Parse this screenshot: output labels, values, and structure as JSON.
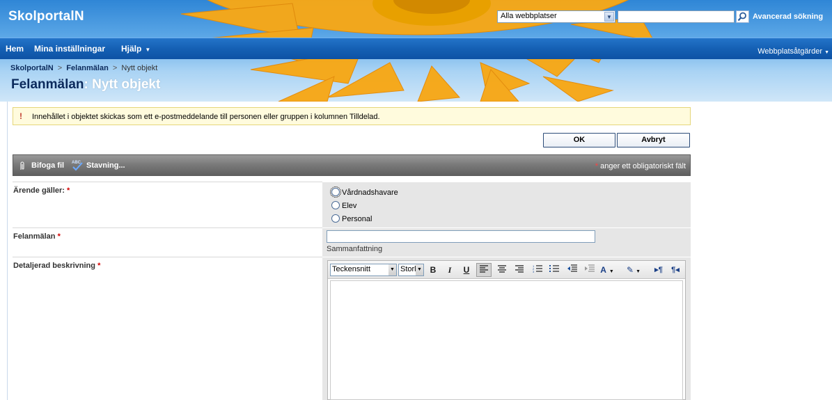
{
  "header": {
    "site_title": "SkolportalN",
    "search_scope": "Alla webbplatser",
    "search_value": "",
    "advanced_search": "Avancerad sökning"
  },
  "topnav": {
    "items": [
      "Hem",
      "Mina inställningar",
      "Hjälp"
    ],
    "site_actions": "Webbplatsåtgärder"
  },
  "breadcrumb": {
    "root": "SkolportalN",
    "list": "Felanmälan",
    "current": "Nytt objekt",
    "separator": ">"
  },
  "page_title": {
    "list": "Felanmälan",
    "separator": ":",
    "item": "Nytt objekt"
  },
  "notice": {
    "text": "Innehållet i objektet skickas som ett e-postmeddelande till personen eller gruppen i kolumnen Tilldelad."
  },
  "actions": {
    "ok": "OK",
    "cancel": "Avbryt"
  },
  "toolbar": {
    "attach": "Bifoga fil",
    "spelling": "Stavning...",
    "required_star": "*",
    "required_note": "anger ett obligatoriskt fält"
  },
  "form": {
    "arende": {
      "label": "Ärende gäller:",
      "star": "*",
      "options": [
        "Vårdnadshavare",
        "Elev",
        "Personal"
      ]
    },
    "felanmalan": {
      "label": "Felanmälan",
      "star": "*",
      "value": "",
      "hint": "Sammanfattning"
    },
    "beskrivning": {
      "label": "Detaljerad beskrivning",
      "star": "*",
      "font_select": "Teckensnitt",
      "size_select": "Storl"
    }
  },
  "colors": {
    "nav_blue": "#1560b4",
    "title_dark": "#0b2a5c",
    "notice_bg": "#fffbdd",
    "toolbar_gray": "#7b7b7b",
    "field_bg": "#e6e6e6",
    "required_red": "#d40000"
  }
}
